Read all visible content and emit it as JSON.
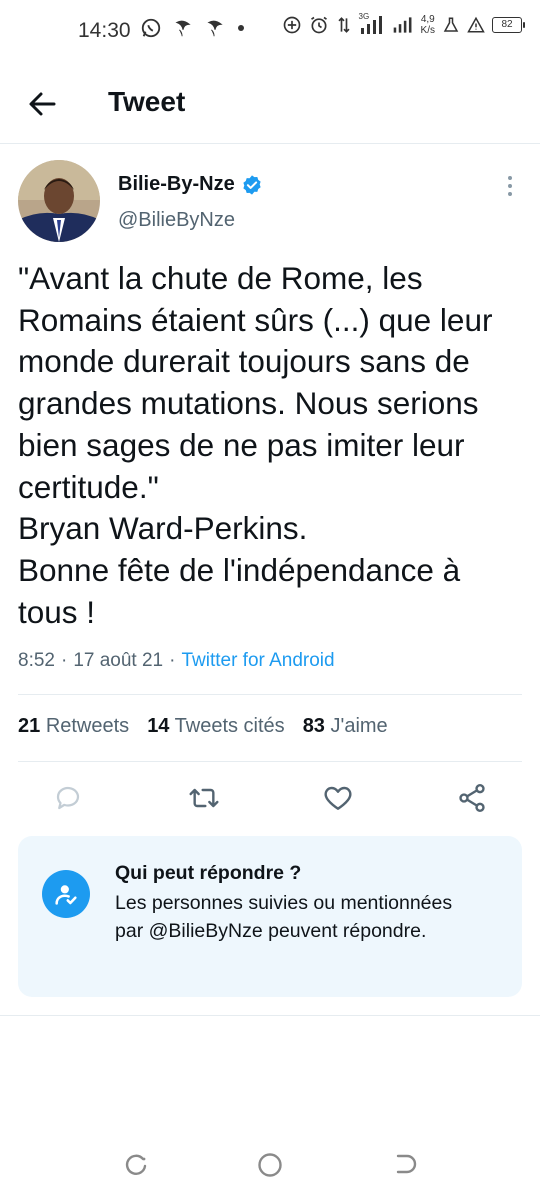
{
  "status_bar": {
    "time": "14:30",
    "network_speed_value": "4,9",
    "network_speed_unit": "K/s",
    "network_type": "3G",
    "battery": "82"
  },
  "header": {
    "title": "Tweet"
  },
  "author": {
    "name": "Bilie-By-Nze",
    "handle": "@BilieByNze",
    "verified": true
  },
  "tweet": {
    "text": "\"Avant la chute de Rome, les Romains étaient sûrs (...) que leur monde durerait toujours sans de grandes mutations. Nous serions bien sages de ne pas imiter leur certitude.\"\nBryan Ward-Perkins.\nBonne fête de l'indépendance à tous !",
    "time": "8:52",
    "separator1": "·",
    "date": "17 août 21",
    "separator2": "·",
    "source": "Twitter for Android"
  },
  "stats": {
    "retweets_count": "21",
    "retweets_label": "Retweets",
    "quotes_count": "14",
    "quotes_label": "Tweets cités",
    "likes_count": "83",
    "likes_label": "J'aime"
  },
  "reply_restriction": {
    "title": "Qui peut répondre ?",
    "description": "Les personnes suivies ou mentionnées par @BilieByNze peuvent répondre."
  },
  "colors": {
    "accent": "#1d9bf0",
    "text": "#0f1419",
    "secondary_text": "#536471",
    "card_background": "#eef7fd"
  }
}
